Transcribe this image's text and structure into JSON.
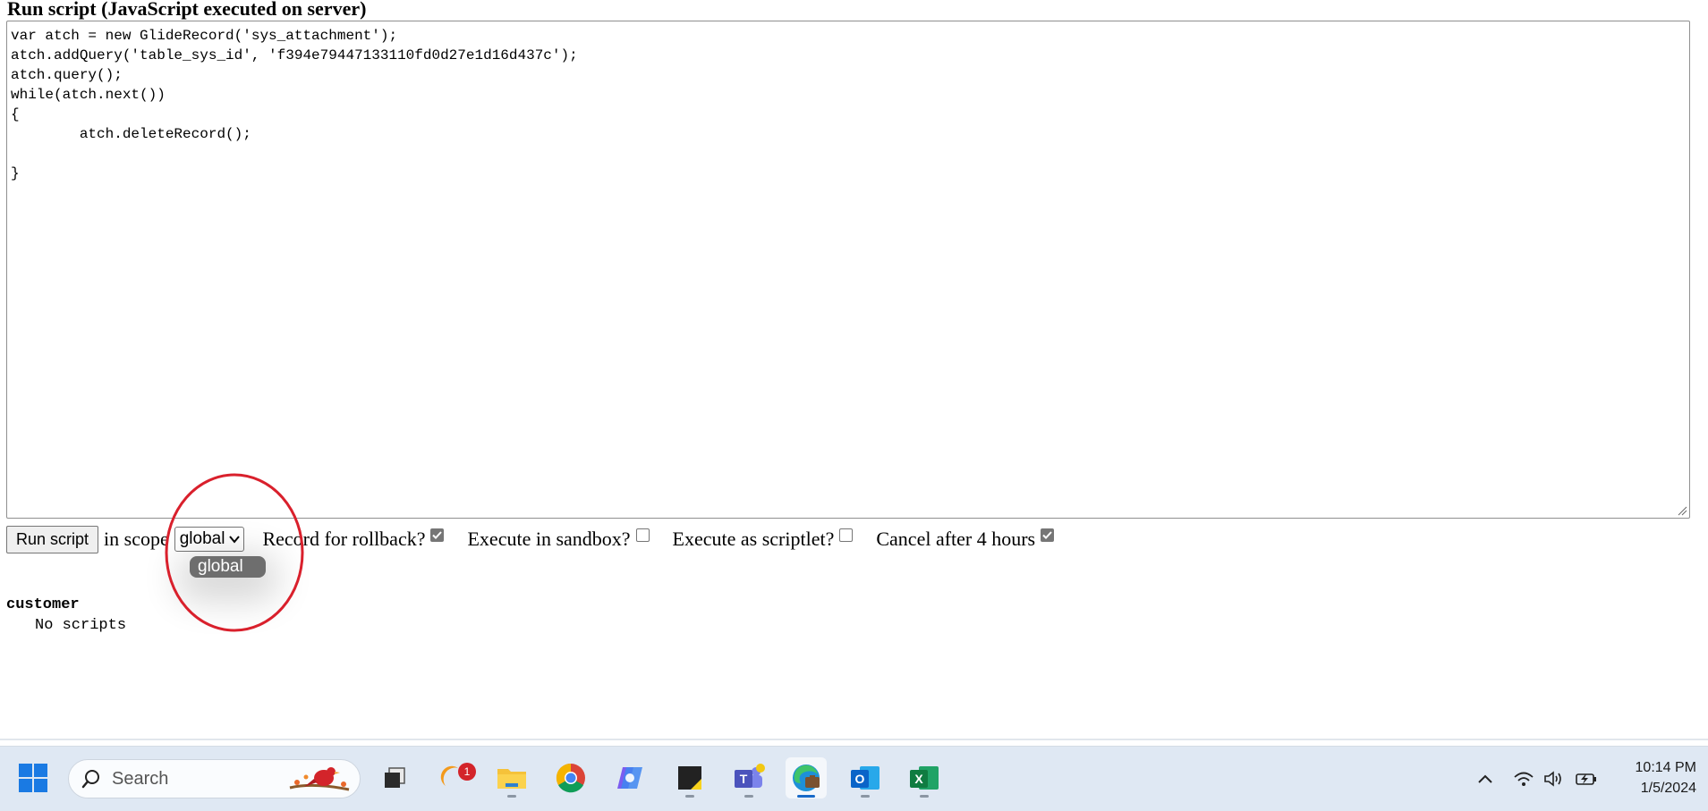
{
  "page": {
    "title": "Run script (JavaScript executed on server)",
    "script": "var atch = new GlideRecord('sys_attachment');\natch.addQuery('table_sys_id', 'f394e79447133110fd0d27e1d16d437c');\natch.query();\nwhile(atch.next())\n{\n        atch.deleteRecord();\n\n}"
  },
  "controls": {
    "run_button": "Run script",
    "scope_label": "in scope",
    "scope_value": "global",
    "rollback_label": "Record for rollback?",
    "rollback_checked": true,
    "sandbox_label": "Execute in sandbox?",
    "sandbox_checked": false,
    "scriptlet_label": "Execute as scriptlet?",
    "scriptlet_checked": false,
    "cancel_label": "Cancel after 4 hours",
    "cancel_checked": true
  },
  "dropdown": {
    "options": [
      "global"
    ]
  },
  "output": {
    "scope": "customer",
    "message": "No scripts"
  },
  "taskbar": {
    "search_placeholder": "Search",
    "notification_count": "1",
    "time": "10:14 PM",
    "date": "1/5/2024",
    "apps": [
      "start-icon",
      "task-view-icon",
      "weather-icon",
      "file-explorer-icon",
      "chrome-icon",
      "copilot-icon",
      "sticky-notes-icon",
      "teams-icon",
      "edge-icon",
      "outlook-icon",
      "excel-icon"
    ]
  },
  "colors": {
    "annotation": "#d9202c",
    "taskbar": "#dfe8f3",
    "active_indicator": "#1769c8"
  }
}
